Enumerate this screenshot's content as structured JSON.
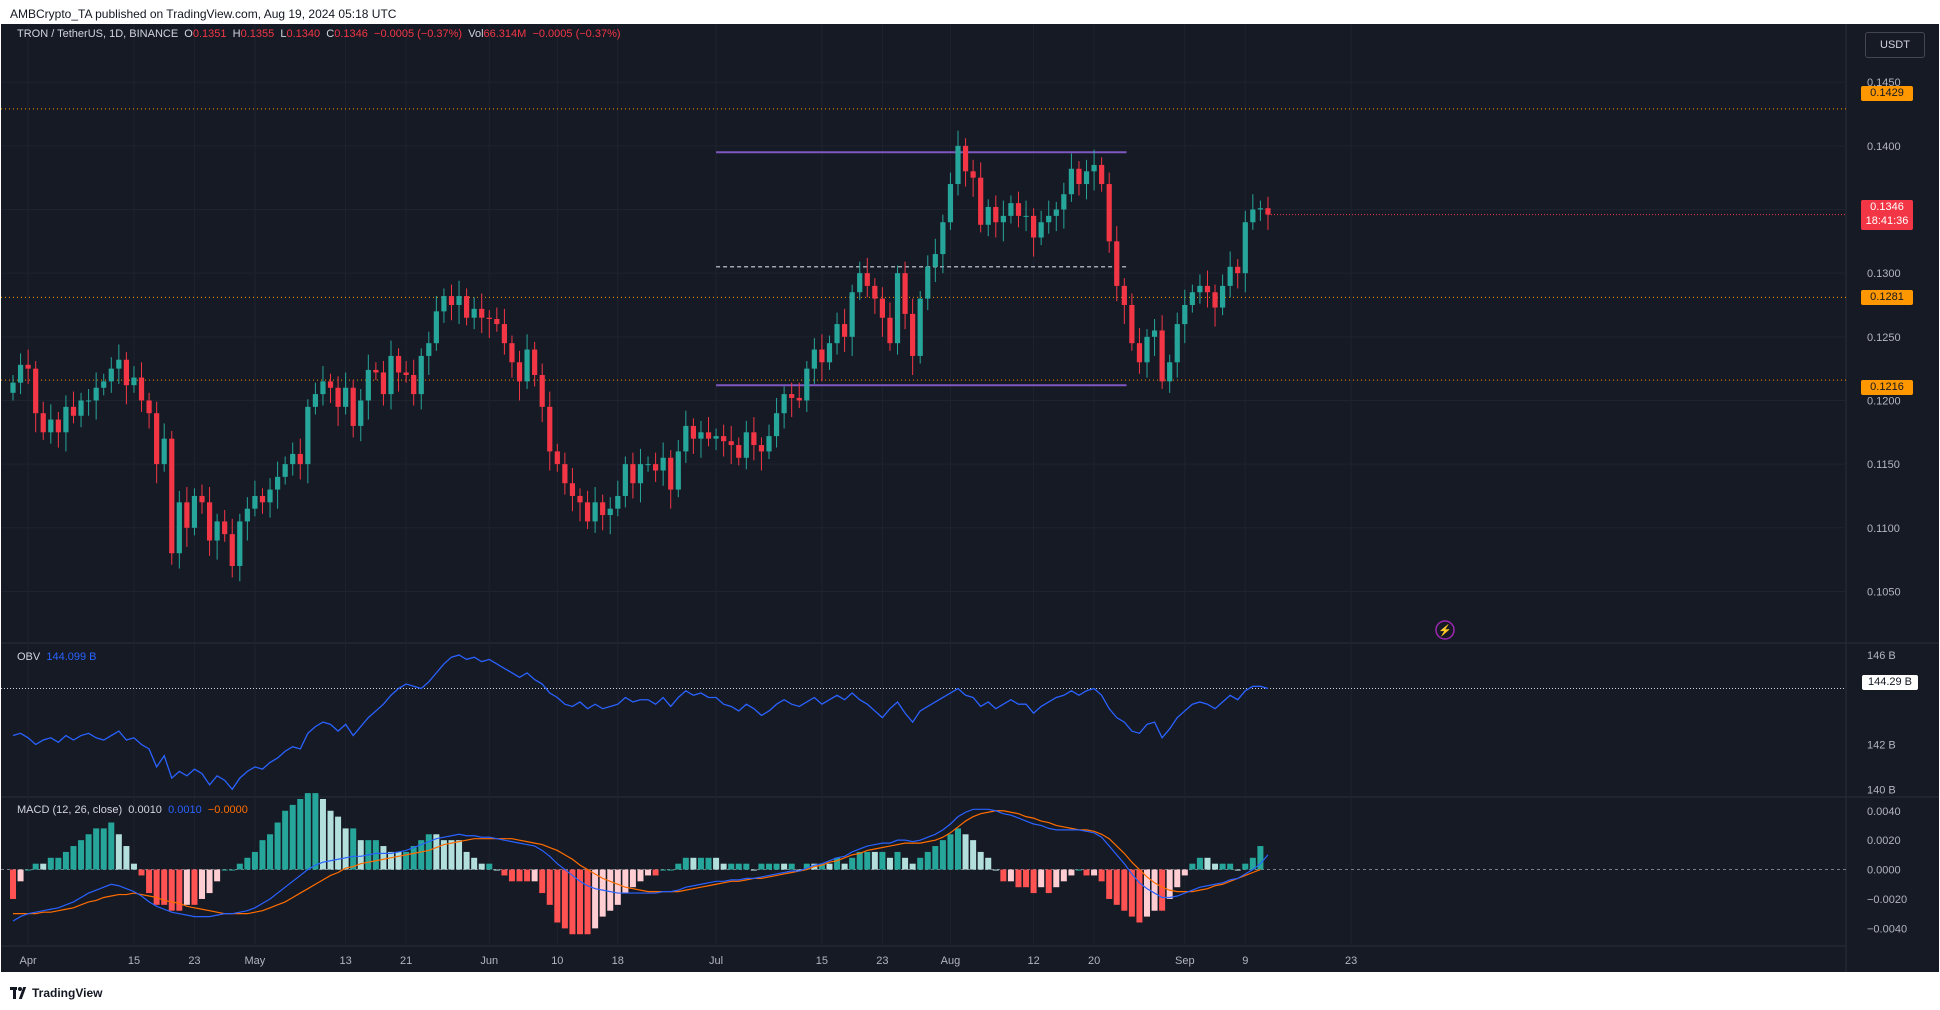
{
  "publisher_line": "AMBCrypto_TA published on TradingView.com, Aug 19, 2024 05:18 UTC",
  "footer_brand": "TradingView",
  "currency": "USDT",
  "legend": {
    "symbol": "TRON / TetherUS, 1D, BINANCE",
    "open_label": "O",
    "open": "0.1351",
    "high_label": "H",
    "high": "0.1355",
    "low_label": "L",
    "low": "0.1340",
    "close_label": "C",
    "close": "0.1346",
    "change": "−0.0005 (−0.37%)",
    "vol_label": "Vol",
    "vol": "66.314M",
    "vol_change": "−0.0005 (−0.37%)"
  },
  "obv_legend": {
    "label": "OBV",
    "value": "144.099 B"
  },
  "macd_legend": {
    "label": "MACD (12, 26, close)",
    "hist": "0.0010",
    "macd": "0.0010",
    "signal": "−0.0000"
  },
  "price_tags": {
    "level_high": "0.1429",
    "level_mid": "0.1281",
    "level_low": "0.1216",
    "last_price": "0.1346",
    "countdown": "18:41:36",
    "obv_last": "144.29 B"
  },
  "colors": {
    "background": "#161a25",
    "up": "#26a69a",
    "down": "#f23645",
    "range_line": "#7e57c2",
    "level_line": "#ff9800",
    "obv": "#2962ff",
    "macd": "#2962ff",
    "signal": "#ff6d00"
  },
  "chart_data": [
    {
      "type": "candlestick",
      "title": "TRON / TetherUS, 1D, BINANCE",
      "ylim": [
        0.1015,
        0.148
      ],
      "price_axis_ticks": [
        "0.1450",
        "0.1400",
        "0.1350",
        "0.1300",
        "0.1250",
        "0.1200",
        "0.1150",
        "0.1100",
        "0.1050"
      ],
      "time_axis_ticks": [
        {
          "label": "Apr",
          "date": "2024-04-01"
        },
        {
          "label": "15",
          "date": "2024-04-15"
        },
        {
          "label": "23",
          "date": "2024-04-23"
        },
        {
          "label": "May",
          "date": "2024-05-01"
        },
        {
          "label": "13",
          "date": "2024-05-13"
        },
        {
          "label": "21",
          "date": "2024-05-21"
        },
        {
          "label": "Jun",
          "date": "2024-06-01"
        },
        {
          "label": "10",
          "date": "2024-06-10"
        },
        {
          "label": "18",
          "date": "2024-06-18"
        },
        {
          "label": "Jul",
          "date": "2024-07-01"
        },
        {
          "label": "15",
          "date": "2024-07-15"
        },
        {
          "label": "23",
          "date": "2024-07-23"
        },
        {
          "label": "Aug",
          "date": "2024-08-01"
        },
        {
          "label": "12",
          "date": "2024-08-12"
        },
        {
          "label": "20",
          "date": "2024-08-20"
        },
        {
          "label": "Sep",
          "date": "2024-09-01"
        },
        {
          "label": "9",
          "date": "2024-09-09"
        },
        {
          "label": "23",
          "date": "2024-09-23"
        }
      ],
      "start_date": "2024-03-30",
      "close": [
        0.1214,
        0.1228,
        0.1225,
        0.119,
        0.1175,
        0.1185,
        0.1175,
        0.1195,
        0.1188,
        0.12,
        0.12,
        0.121,
        0.1215,
        0.1225,
        0.1232,
        0.1212,
        0.1218,
        0.12,
        0.119,
        0.115,
        0.117,
        0.108,
        0.112,
        0.11,
        0.1125,
        0.112,
        0.109,
        0.1105,
        0.1095,
        0.107,
        0.1105,
        0.1115,
        0.1125,
        0.112,
        0.113,
        0.114,
        0.115,
        0.1158,
        0.115,
        0.1195,
        0.1205,
        0.1215,
        0.121,
        0.1195,
        0.121,
        0.118,
        0.12,
        0.1224,
        0.1222,
        0.1205,
        0.1235,
        0.1222,
        0.122,
        0.1205,
        0.1235,
        0.1245,
        0.127,
        0.1282,
        0.1275,
        0.1282,
        0.1265,
        0.1272,
        0.1265,
        0.1264,
        0.126,
        0.1245,
        0.123,
        0.1215,
        0.124,
        0.122,
        0.1195,
        0.116,
        0.115,
        0.1135,
        0.1125,
        0.112,
        0.1105,
        0.112,
        0.111,
        0.1115,
        0.1125,
        0.115,
        0.1135,
        0.115,
        0.115,
        0.1145,
        0.1155,
        0.113,
        0.116,
        0.118,
        0.117,
        0.1175,
        0.117,
        0.1172,
        0.1168,
        0.1165,
        0.1155,
        0.1175,
        0.1165,
        0.116,
        0.1172,
        0.119,
        0.1205,
        0.1202,
        0.12,
        0.1225,
        0.124,
        0.123,
        0.1245,
        0.126,
        0.125,
        0.1285,
        0.13,
        0.129,
        0.128,
        0.1265,
        0.1245,
        0.13,
        0.1268,
        0.1235,
        0.128,
        0.1305,
        0.1315,
        0.134,
        0.137,
        0.14,
        0.138,
        0.1375,
        0.1338,
        0.1352,
        0.134,
        0.1345,
        0.1355,
        0.1345,
        0.1345,
        0.1328,
        0.134,
        0.1345,
        0.135,
        0.1362,
        0.1382,
        0.137,
        0.138,
        0.1385,
        0.137,
        0.1325,
        0.129,
        0.1275,
        0.1245,
        0.123,
        0.125,
        0.1255,
        0.1215,
        0.123,
        0.126,
        0.1275,
        0.1285,
        0.129,
        0.1285,
        0.1273,
        0.129,
        0.1305,
        0.13,
        0.134,
        0.135,
        0.1351,
        0.1346
      ],
      "series": [
        {
          "name": "OBV",
          "unit": "B",
          "ylim": [
            139.7,
            146.4
          ],
          "axis_ticks": [
            "146 B",
            "142 B",
            "140 B"
          ],
          "values": [
            142.4,
            142.5,
            142.3,
            142.0,
            142.2,
            142.3,
            142.1,
            142.4,
            142.2,
            142.4,
            142.5,
            142.3,
            142.2,
            142.4,
            142.6,
            142.2,
            142.3,
            142.0,
            141.8,
            141.0,
            141.5,
            140.5,
            140.8,
            140.6,
            140.9,
            140.7,
            140.2,
            140.6,
            140.4,
            140.0,
            140.5,
            140.8,
            141.0,
            140.9,
            141.2,
            141.4,
            141.7,
            141.9,
            141.8,
            142.5,
            142.8,
            143.0,
            142.9,
            142.6,
            142.9,
            142.4,
            142.8,
            143.2,
            143.5,
            143.8,
            144.2,
            144.5,
            144.7,
            144.6,
            144.5,
            144.8,
            145.2,
            145.6,
            145.9,
            146.0,
            145.8,
            145.9,
            145.7,
            145.8,
            145.6,
            145.4,
            145.2,
            145.0,
            145.2,
            144.9,
            144.7,
            144.3,
            144.1,
            143.8,
            143.7,
            143.9,
            143.6,
            143.8,
            143.6,
            143.7,
            143.8,
            144.1,
            143.9,
            144.0,
            144.0,
            143.8,
            144.1,
            143.7,
            144.1,
            144.4,
            144.2,
            144.3,
            144.1,
            144.1,
            143.8,
            143.7,
            143.5,
            143.8,
            143.6,
            143.3,
            143.5,
            143.8,
            144.0,
            143.8,
            143.7,
            143.9,
            144.1,
            143.8,
            144.0,
            144.2,
            144.0,
            144.3,
            144.0,
            143.8,
            143.5,
            143.2,
            143.6,
            143.9,
            143.4,
            143.0,
            143.5,
            143.7,
            143.9,
            144.1,
            144.3,
            144.5,
            144.2,
            144.1,
            143.7,
            143.9,
            143.6,
            143.8,
            144.0,
            143.8,
            143.8,
            143.4,
            143.7,
            143.9,
            144.1,
            144.2,
            144.4,
            144.2,
            144.4,
            144.5,
            144.2,
            143.6,
            143.2,
            143.0,
            142.6,
            142.5,
            142.9,
            143.0,
            142.3,
            142.7,
            143.2,
            143.5,
            143.8,
            143.9,
            143.8,
            143.6,
            143.9,
            144.2,
            144.0,
            144.4,
            144.6,
            144.6,
            144.5
          ]
        },
        {
          "name": "MACD",
          "ylim": [
            -0.0052,
            0.0048
          ],
          "axis_ticks": [
            "0.0040",
            "0.0020",
            "0.0000",
            "−0.0020",
            "−0.0040"
          ],
          "values": [
            -0.0035,
            -0.0032,
            -0.003,
            -0.0029,
            -0.0028,
            -0.0027,
            -0.0026,
            -0.0024,
            -0.0022,
            -0.0019,
            -0.0016,
            -0.0014,
            -0.0012,
            -0.001,
            -0.0011,
            -0.0013,
            -0.0015,
            -0.0018,
            -0.0022,
            -0.0025,
            -0.0027,
            -0.0029,
            -0.003,
            -0.0031,
            -0.0032,
            -0.0032,
            -0.0032,
            -0.0031,
            -0.003,
            -0.003,
            -0.0029,
            -0.0028,
            -0.0026,
            -0.0023,
            -0.002,
            -0.0016,
            -0.0012,
            -0.0008,
            -0.0004,
            0.0,
            0.0003,
            0.0005,
            0.0006,
            0.0007,
            0.0008,
            0.0009,
            0.0009,
            0.001,
            0.0011,
            0.0011,
            0.0011,
            0.0012,
            0.0013,
            0.0015,
            0.0017,
            0.0019,
            0.0021,
            0.0022,
            0.0023,
            0.0024,
            0.0023,
            0.0023,
            0.0022,
            0.0022,
            0.0021,
            0.002,
            0.0019,
            0.0018,
            0.0017,
            0.0016,
            0.0013,
            0.0009,
            0.0004,
            0.0,
            -0.0004,
            -0.0008,
            -0.0011,
            -0.0013,
            -0.0014,
            -0.0015,
            -0.0016,
            -0.0016,
            -0.0016,
            -0.0016,
            -0.0016,
            -0.0016,
            -0.0015,
            -0.0015,
            -0.0014,
            -0.0012,
            -0.0011,
            -0.001,
            -0.0009,
            -0.0008,
            -0.0008,
            -0.0007,
            -0.0007,
            -0.0006,
            -0.0006,
            -0.0005,
            -0.0004,
            -0.0003,
            -0.0002,
            -0.0001,
            -0.0001,
            0.0001,
            0.0003,
            0.0004,
            0.0006,
            0.0008,
            0.0009,
            0.0012,
            0.0014,
            0.0016,
            0.0017,
            0.0018,
            0.0018,
            0.002,
            0.002,
            0.0019,
            0.002,
            0.0022,
            0.0024,
            0.0027,
            0.0031,
            0.0036,
            0.0039,
            0.0041,
            0.0041,
            0.0041,
            0.004,
            0.0038,
            0.0037,
            0.0035,
            0.0033,
            0.0031,
            0.003,
            0.0028,
            0.0027,
            0.0027,
            0.0027,
            0.0027,
            0.0026,
            0.0025,
            0.0022,
            0.0016,
            0.001,
            0.0004,
            -0.0003,
            -0.0009,
            -0.0013,
            -0.0016,
            -0.0019,
            -0.0019,
            -0.0018,
            -0.0016,
            -0.0014,
            -0.0012,
            -0.0011,
            -0.001,
            -0.0009,
            -0.0007,
            -0.0006,
            -0.0003,
            0.0,
            0.0004,
            0.001
          ]
        },
        {
          "name": "Signal",
          "values": [
            -0.003,
            -0.003,
            -0.003,
            -0.003,
            -0.0029,
            -0.0029,
            -0.0028,
            -0.0027,
            -0.0026,
            -0.0024,
            -0.0022,
            -0.0021,
            -0.0019,
            -0.0018,
            -0.0017,
            -0.0017,
            -0.0016,
            -0.0017,
            -0.0018,
            -0.0019,
            -0.0021,
            -0.0022,
            -0.0023,
            -0.0025,
            -0.0026,
            -0.0027,
            -0.0028,
            -0.0029,
            -0.003,
            -0.003,
            -0.003,
            -0.003,
            -0.0029,
            -0.0028,
            -0.0026,
            -0.0024,
            -0.0022,
            -0.0019,
            -0.0016,
            -0.0013,
            -0.001,
            -0.0007,
            -0.0004,
            -0.0002,
            0.0001,
            0.0002,
            0.0004,
            0.0005,
            0.0006,
            0.0007,
            0.0008,
            0.0009,
            0.001,
            0.0011,
            0.0012,
            0.0013,
            0.0015,
            0.0017,
            0.0018,
            0.0019,
            0.002,
            0.0021,
            0.0021,
            0.0021,
            0.0021,
            0.0021,
            0.0021,
            0.002,
            0.0019,
            0.0018,
            0.0017,
            0.0015,
            0.0013,
            0.001,
            0.0007,
            0.0003,
            0.0,
            -0.0003,
            -0.0006,
            -0.0008,
            -0.001,
            -0.0012,
            -0.0013,
            -0.0014,
            -0.0015,
            -0.0015,
            -0.0015,
            -0.0015,
            -0.0015,
            -0.0014,
            -0.0013,
            -0.0012,
            -0.0011,
            -0.001,
            -0.0009,
            -0.0008,
            -0.0008,
            -0.0007,
            -0.0006,
            -0.0006,
            -0.0005,
            -0.0004,
            -0.0003,
            -0.0002,
            -0.0001,
            0.0,
            0.0002,
            0.0003,
            0.0005,
            0.0006,
            0.0008,
            0.001,
            0.0011,
            0.0013,
            0.0014,
            0.0015,
            0.0016,
            0.0017,
            0.0018,
            0.0018,
            0.0018,
            0.0019,
            0.002,
            0.0022,
            0.0025,
            0.0029,
            0.0033,
            0.0036,
            0.0038,
            0.0039,
            0.004,
            0.004,
            0.0039,
            0.0038,
            0.0036,
            0.0035,
            0.0033,
            0.0032,
            0.003,
            0.0029,
            0.0028,
            0.0027,
            0.0027,
            0.0026,
            0.0024,
            0.0021,
            0.0016,
            0.0011,
            0.0005,
            0.0,
            -0.0005,
            -0.0009,
            -0.0012,
            -0.0014,
            -0.0015,
            -0.0015,
            -0.0015,
            -0.0014,
            -0.0013,
            -0.0011,
            -0.001,
            -0.0008,
            -0.0006,
            -0.0004,
            -0.0002,
            0.0
          ]
        }
      ],
      "horizontal_levels": [
        0.1429,
        0.1281,
        0.1216
      ],
      "range_box": {
        "start_date": "2024-07-01",
        "end_date": "2024-08-19",
        "top": 0.1395,
        "mid": 0.1305,
        "bottom": 0.1212
      },
      "grid": true
    }
  ]
}
